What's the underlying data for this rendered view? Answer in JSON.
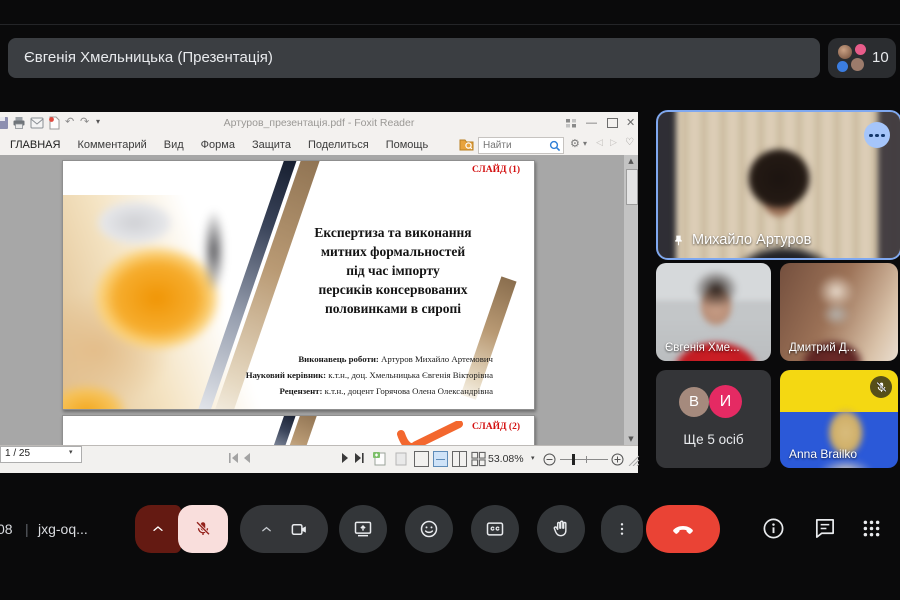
{
  "meet": {
    "presenter_banner": "Євгенія Хмельницька (Презентація)",
    "participants_count": "10",
    "clock": "08",
    "meeting_code": "jxg-oq...",
    "tiles": {
      "main": {
        "name": "Михайло Артуров"
      },
      "tile2": {
        "name": "Євгенія Хме..."
      },
      "tile3": {
        "name": "Дмитрий Д..."
      },
      "more": {
        "label": "Ще 5 осіб",
        "avatar1": "В",
        "avatar2": "И"
      },
      "tile5": {
        "name": "Anna Brailko"
      }
    }
  },
  "foxit": {
    "window_title": "Артуров_презентація.pdf - Foxit Reader",
    "menu": [
      "ГЛАВНАЯ",
      "Комментарий",
      "Вид",
      "Форма",
      "Защита",
      "Поделиться",
      "Помощь"
    ],
    "search_placeholder": "Найти",
    "status": {
      "page_indicator": "1 / 25",
      "zoom_level": "53.08%"
    }
  },
  "slides": {
    "slide1": {
      "badge": "СЛАЙД (1)",
      "title_lines": [
        "Експертиза та виконання",
        "митних формальностей",
        "під час імпорту",
        "персиків консервованих",
        "половинками в сиропі"
      ],
      "authors": [
        {
          "label": "Виконавець роботи:",
          "value": " Артуров Михайло Артемович"
        },
        {
          "label": "Науковий керівник:",
          "value": " к.т.н., доц. Хмельницька Євгенія Вікторівна"
        },
        {
          "label": "Рецензент:",
          "value": " к.т.н., доцент Горячова Олена Олександрівна"
        }
      ]
    },
    "slide2": {
      "badge": "СЛАЙД (2)"
    }
  },
  "colors": {
    "speaking_border_blue": "#7fa8f0",
    "end_call_red": "#ea4335",
    "mic_muted_pink": "#f9dedc",
    "mic_muted_dark_red": "#641a12",
    "slide_badge_red": "#d31111",
    "flag_yellow": "#f4d812",
    "flag_blue": "#2b59d8"
  }
}
